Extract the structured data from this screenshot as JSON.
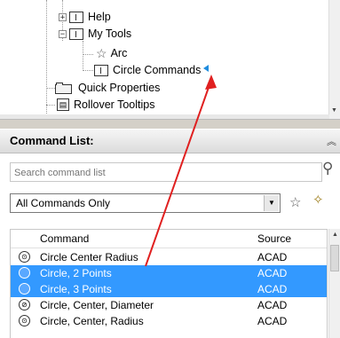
{
  "tree": {
    "items": [
      {
        "label": "Help",
        "expander": "+"
      },
      {
        "label": "My Tools",
        "expander": "−"
      },
      {
        "label": "Arc"
      },
      {
        "label": "Circle Commands"
      },
      {
        "label": "Quick Properties"
      },
      {
        "label": "Rollover Tooltips"
      }
    ]
  },
  "command_list": {
    "title": "Command List:",
    "collapse_icon": "double-chevron-up-icon"
  },
  "search": {
    "placeholder": "Search command list"
  },
  "filter": {
    "selected": "All Commands Only",
    "options_visible": [
      "All Commands Only"
    ]
  },
  "grid": {
    "columns": [
      "Command",
      "Source"
    ],
    "rows": [
      {
        "command": "Circle Center Radius",
        "source": "ACAD",
        "selected": false
      },
      {
        "command": "Circle, 2 Points",
        "source": "ACAD",
        "selected": true
      },
      {
        "command": "Circle, 3 Points",
        "source": "ACAD",
        "selected": true
      },
      {
        "command": "Circle, Center, Diameter",
        "source": "ACAD",
        "selected": false
      },
      {
        "command": "Circle, Center, Radius",
        "source": "ACAD",
        "selected": false
      }
    ]
  },
  "colors": {
    "selection": "#3399ff",
    "annotation_arrow": "#e02020",
    "insert_marker": "#1f8cde"
  }
}
